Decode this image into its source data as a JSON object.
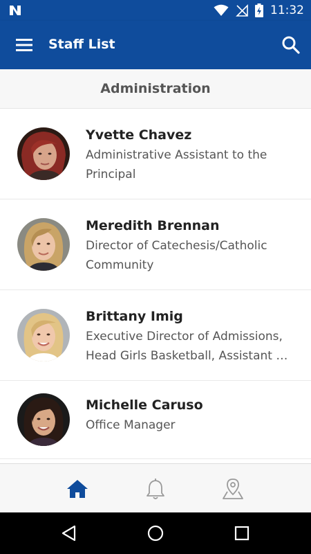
{
  "status_bar": {
    "time": "11:32",
    "icons": [
      "notification-n-icon",
      "wifi-icon",
      "no-sim-icon",
      "battery-charging-icon"
    ]
  },
  "app_bar": {
    "title": "Staff List",
    "icons": [
      "menu-icon",
      "search-icon"
    ]
  },
  "section": {
    "title": "Administration"
  },
  "staff": [
    {
      "name": "Yvette Chavez",
      "role_lines": [
        "Administrative Assistant to the",
        "Principal"
      ]
    },
    {
      "name": "Meredith Brennan",
      "role_lines": [
        "Director of Catechesis/Catholic",
        "Community"
      ]
    },
    {
      "name": "Brittany Imig",
      "role_lines": [
        "Executive Director of Admissions,",
        "Head Girls Basketball, Assistant A…"
      ]
    },
    {
      "name": "Michelle Caruso",
      "role_lines": [
        "Office Manager"
      ]
    }
  ],
  "bottom_nav": {
    "tabs": [
      "home-icon",
      "bell-icon",
      "map-pin-icon"
    ],
    "active_color": "#0f4c9c",
    "inactive_color": "#9a9a9a"
  },
  "colors": {
    "primary": "#0f4c9c"
  }
}
